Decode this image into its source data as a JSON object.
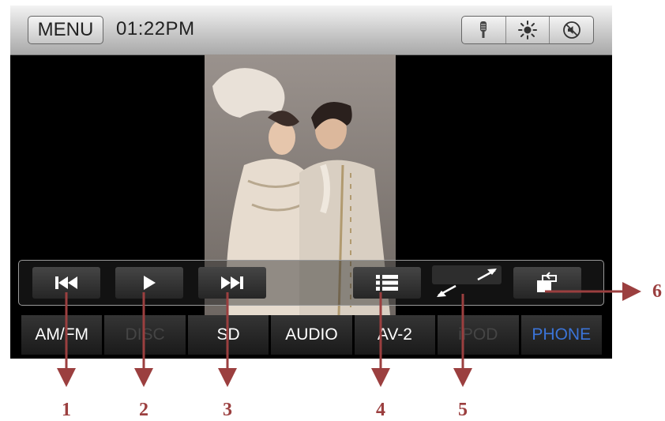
{
  "status_bar": {
    "menu_label": "MENU",
    "time": "01:22PM",
    "icons": [
      "microphone-icon",
      "brightness-icon",
      "mute-icon"
    ]
  },
  "playback_controls": [
    "previous-track-icon",
    "play-icon",
    "next-track-icon",
    "playlist-icon",
    "fullscreen-icon",
    "rotate-icon"
  ],
  "source_tabs": [
    {
      "label": "AM/FM",
      "state": "normal"
    },
    {
      "label": "DISC",
      "state": "disabled"
    },
    {
      "label": "SD",
      "state": "normal"
    },
    {
      "label": "AUDIO",
      "state": "normal"
    },
    {
      "label": "AV-2",
      "state": "normal"
    },
    {
      "label": "iPOD",
      "state": "disabled"
    },
    {
      "label": "PHONE",
      "state": "active"
    }
  ],
  "callouts": [
    "1",
    "2",
    "3",
    "4",
    "5",
    "6"
  ],
  "colors": {
    "callout": "#9b3f3f",
    "active_tab": "#3b74d8",
    "screen_bg": "#000000"
  }
}
